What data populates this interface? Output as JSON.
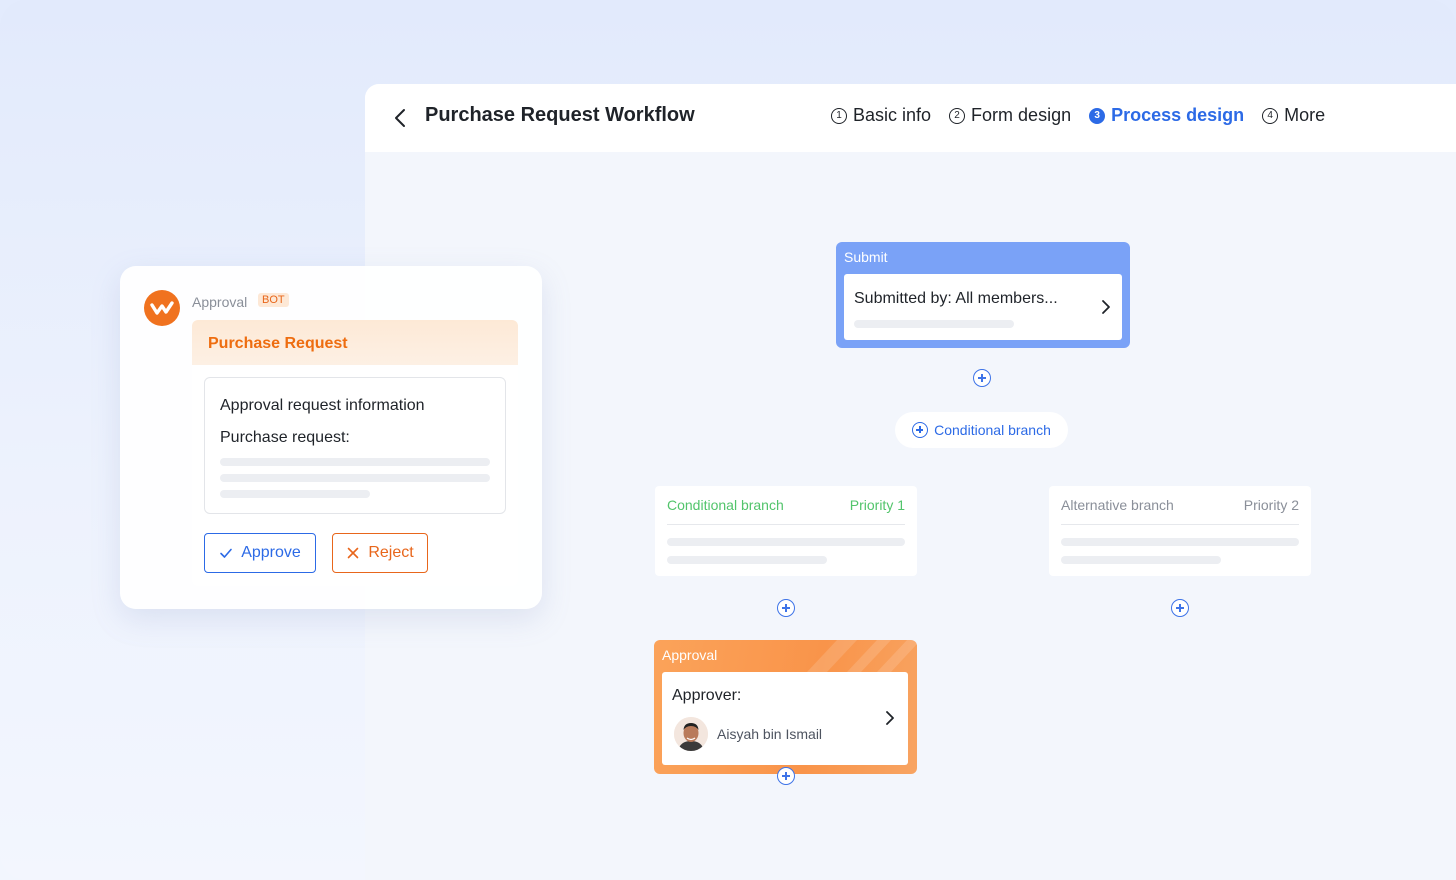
{
  "app": {
    "title": "Purchase Request Workflow",
    "back_icon": "chevron-left-icon"
  },
  "steps": [
    {
      "num": "1",
      "label": "Basic info",
      "active": false
    },
    {
      "num": "2",
      "label": "Form design",
      "active": false
    },
    {
      "num": "3",
      "label": "Process design",
      "active": true
    },
    {
      "num": "4",
      "label": "More",
      "active": false
    }
  ],
  "flow": {
    "submit": {
      "label": "Submit",
      "text": "Submitted by: All members..."
    },
    "branch_pill": "Conditional branch",
    "branches": [
      {
        "title": "Conditional branch",
        "priority": "Priority 1",
        "color": "#52c46b"
      },
      {
        "title": "Alternative branch",
        "priority": "Priority 2",
        "color": "#8a8f99"
      }
    ],
    "approval": {
      "label": "Approval",
      "approver_label": "Approver:",
      "approver_name": "Aisyah bin Ismail"
    }
  },
  "bot": {
    "name": "Approval",
    "badge": "BOT",
    "card_title": "Purchase Request",
    "info_title": "Approval request information",
    "info_sub": "Purchase request:",
    "approve_label": "Approve",
    "reject_label": "Reject"
  },
  "colors": {
    "accent": "#2c6ae6",
    "submit_node": "#7aa2f7",
    "approval_node": "#f9944a",
    "reject": "#e8661b",
    "success": "#52c46b"
  }
}
